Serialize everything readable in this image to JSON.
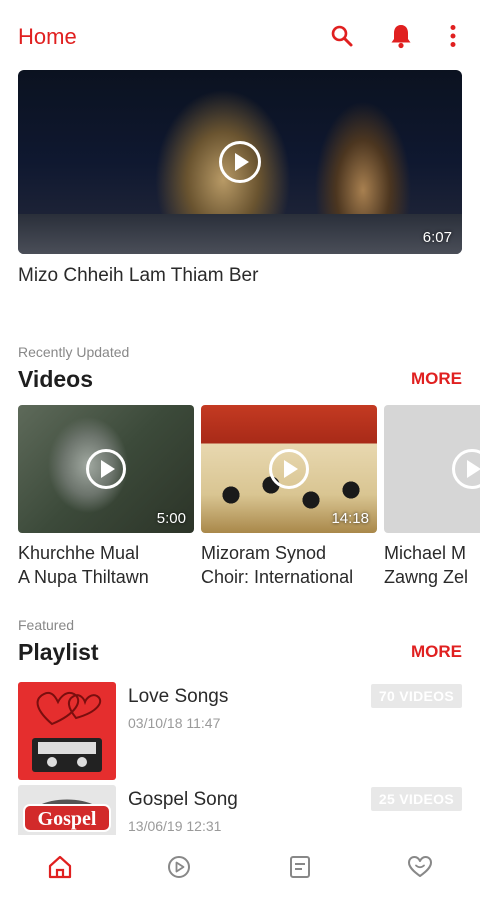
{
  "header": {
    "title": "Home",
    "icons": [
      "search-icon",
      "bell-icon",
      "more-vertical-icon"
    ],
    "accent": "#e02020"
  },
  "hero": {
    "title": "Mizo Chheih Lam Thiam Ber",
    "duration": "6:07"
  },
  "videos_section": {
    "subtitle": "Recently Updated",
    "title": "Videos",
    "more_label": "MORE",
    "items": [
      {
        "title_line1": "Khurchhe Mual",
        "title_line2": "A Nupa Thiltawn",
        "duration": "5:00"
      },
      {
        "title_line1": "Mizoram Synod",
        "title_line2": "Choir: International",
        "duration": "14:18"
      },
      {
        "title_line1": "Michael M",
        "title_line2": "Zawng Zel",
        "duration": ""
      }
    ]
  },
  "playlist_section": {
    "subtitle": "Featured",
    "title": "Playlist",
    "more_label": "MORE",
    "items": [
      {
        "name": "Love Songs",
        "date": "03/10/18 11:47",
        "count": "70 VIDEOS"
      },
      {
        "name": "Gospel Song",
        "date": "13/06/19 12:31",
        "count": "25 VIDEOS",
        "thumb_text": "Gospel"
      }
    ]
  },
  "bottom_nav": {
    "items": [
      "home-icon",
      "play-icon",
      "list-icon",
      "heart-icon"
    ],
    "active_color": "#e02020",
    "inactive_color": "#888888"
  }
}
